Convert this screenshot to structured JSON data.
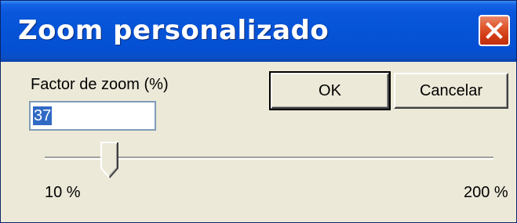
{
  "window": {
    "title": "Zoom personalizado",
    "close_icon": "close-icon"
  },
  "form": {
    "zoom_label": "Factor de zoom (%)",
    "zoom_value": "37",
    "ok_label": "OK",
    "cancel_label": "Cancelar"
  },
  "slider": {
    "min_label": "10 %",
    "max_label": "200 %",
    "min": 10,
    "max": 200,
    "value": 37
  },
  "colors": {
    "title_bar": "#0553d6",
    "close_button": "#d03a14",
    "dialog_background": "#ece9d8",
    "selection": "#316ac5"
  }
}
